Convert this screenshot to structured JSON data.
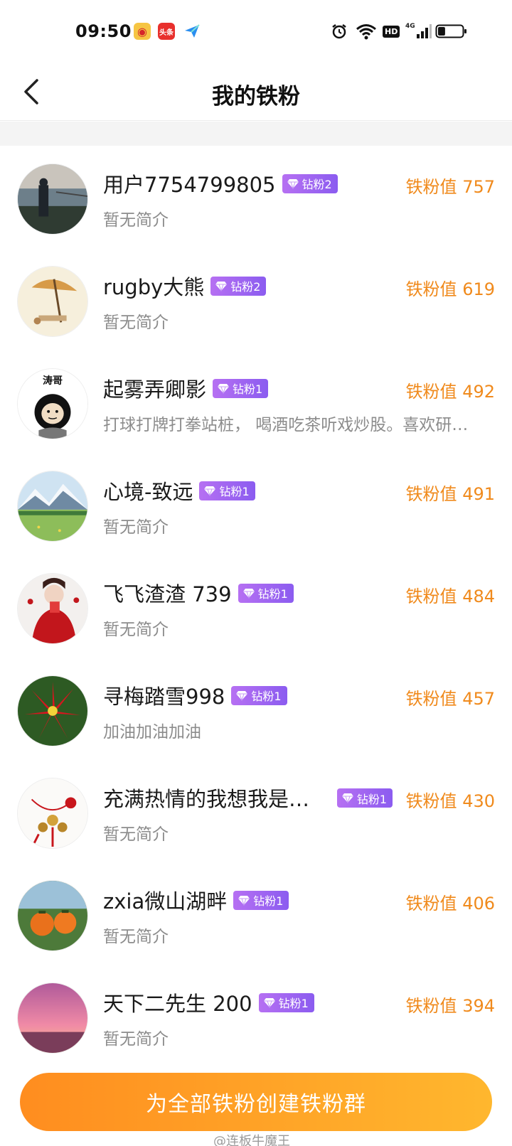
{
  "status_bar": {
    "time": "09:50",
    "apps": [
      "weibo-icon",
      "toutiao-icon",
      "send-icon"
    ],
    "toutiao_label": "头条",
    "right_icons": [
      "alarm-icon",
      "wifi-icon",
      "hd-icon",
      "signal-4g-icon",
      "battery-icon"
    ],
    "hd_label": "HD",
    "net_label": "4G",
    "battery_level": 0.3
  },
  "header": {
    "title": "我的铁粉",
    "back_icon": "chevron-left-icon"
  },
  "fans": [
    {
      "name": "用户7754799805",
      "badge": "钻粉2",
      "score": "铁粉值 757",
      "bio": "暂无简介"
    },
    {
      "name": "rugby大熊",
      "badge": "钻粉2",
      "score": "铁粉值 619",
      "bio": "暂无简介"
    },
    {
      "name": "起雾弄卿影",
      "badge": "钻粉1",
      "score": "铁粉值 492",
      "bio": "打球打牌打拳站桩， 喝酒吃茶听戏炒股。喜欢研…"
    },
    {
      "name": "心境-致远",
      "badge": "钻粉1",
      "score": "铁粉值 491",
      "bio": "暂无简介"
    },
    {
      "name": "飞飞渣渣 739",
      "badge": "钻粉1",
      "score": "铁粉值 484",
      "bio": "暂无简介"
    },
    {
      "name": "寻梅踏雪998",
      "badge": "钻粉1",
      "score": "铁粉值 457",
      "bio": "加油加油加油"
    },
    {
      "name": "充满热情的我想我是…",
      "badge": "钻粉1",
      "score": "铁粉值 430",
      "bio": "暂无简介"
    },
    {
      "name": "zxia微山湖畔",
      "badge": "钻粉1",
      "score": "铁粉值 406",
      "bio": "暂无简介"
    },
    {
      "name": "天下二先生 200",
      "badge": "钻粉1",
      "score": "铁粉值 394",
      "bio": "暂无简介"
    }
  ],
  "avatar_text": {
    "fan3": "涛哥"
  },
  "footer": {
    "create_button": "为全部铁粉创建铁粉群",
    "watermark": "@连板牛魔王"
  },
  "colors": {
    "score": "#f08a1c",
    "badge_start": "#b670f2",
    "badge_end": "#8b5cf0",
    "button_start": "#ff8d1f",
    "button_end": "#ffb72e"
  }
}
